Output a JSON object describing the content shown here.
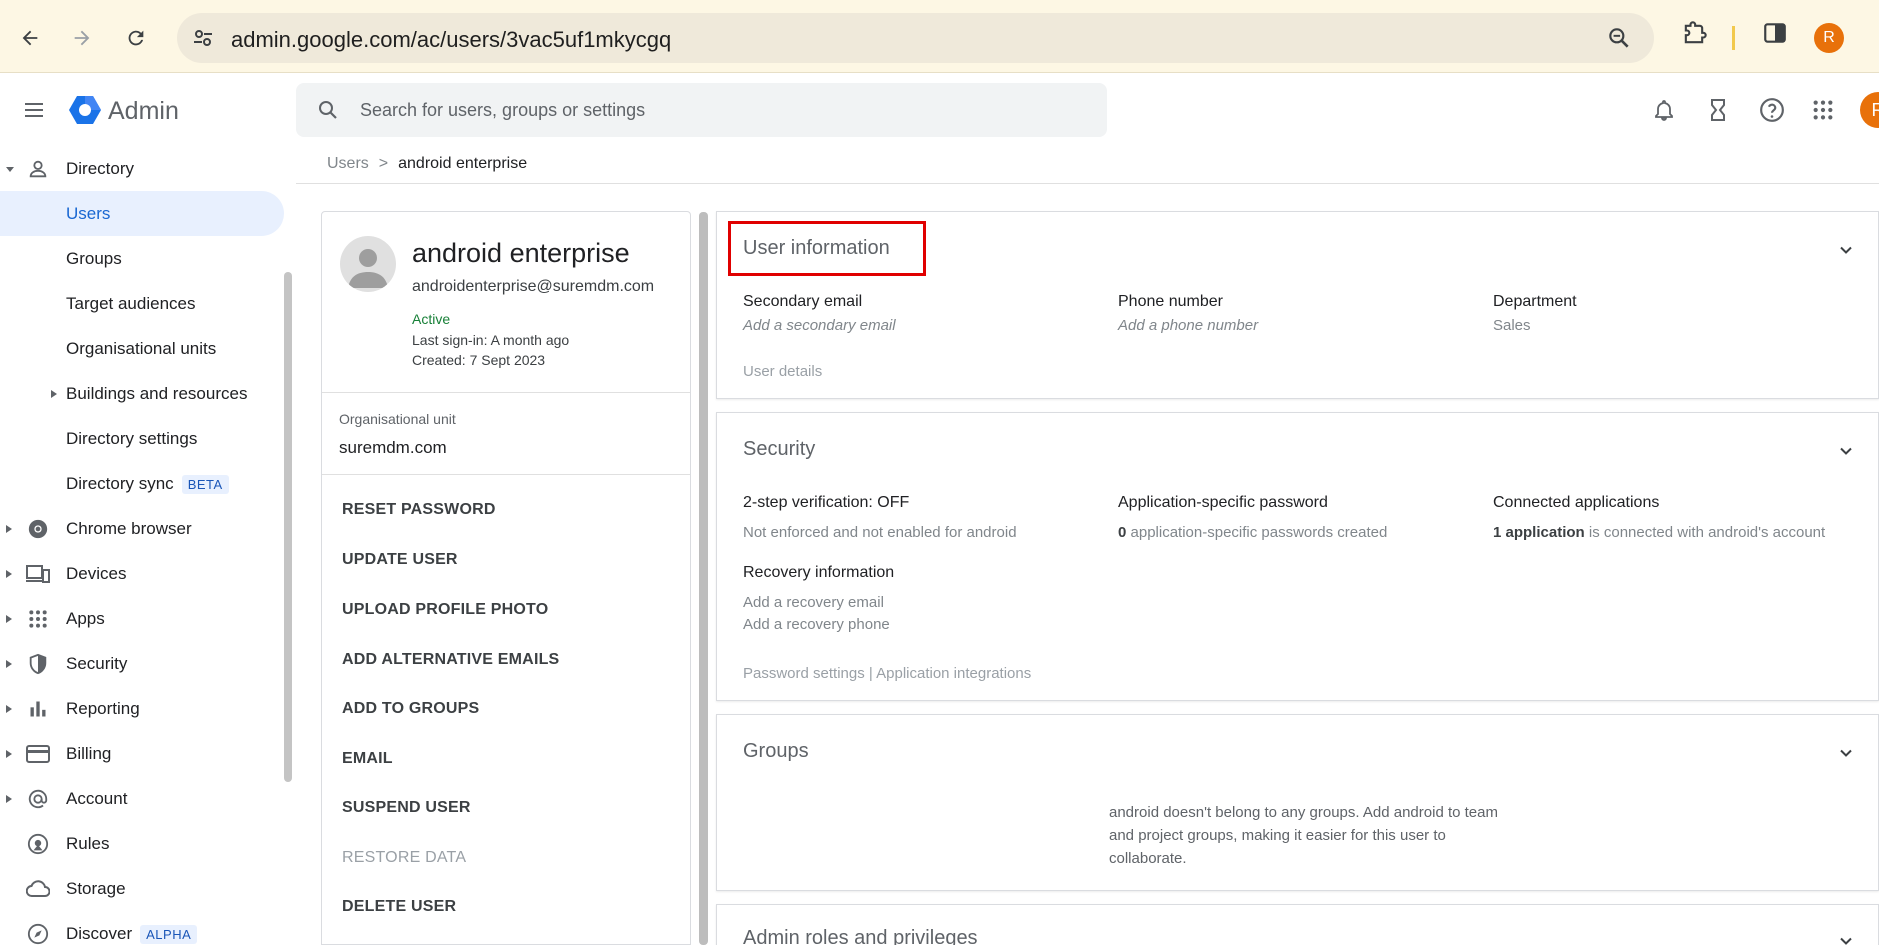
{
  "browser": {
    "url": "admin.google.com/ac/users/3vac5uf1mkycgq",
    "profile_initial": "R"
  },
  "header": {
    "app_title": "Admin",
    "search_placeholder": "Search for users, groups or settings",
    "profile_initial": "R"
  },
  "sidebar": {
    "items": [
      {
        "label": "Directory",
        "icon": "person-icon"
      },
      {
        "label": "Users"
      },
      {
        "label": "Groups"
      },
      {
        "label": "Target audiences"
      },
      {
        "label": "Organisational units"
      },
      {
        "label": "Buildings and resources"
      },
      {
        "label": "Directory settings"
      },
      {
        "label": "Directory sync",
        "badge": "BETA"
      },
      {
        "label": "Chrome browser",
        "icon": "chrome-icon"
      },
      {
        "label": "Devices",
        "icon": "devices-icon"
      },
      {
        "label": "Apps",
        "icon": "apps-grid-icon"
      },
      {
        "label": "Security",
        "icon": "shield-icon"
      },
      {
        "label": "Reporting",
        "icon": "bar-chart-icon"
      },
      {
        "label": "Billing",
        "icon": "credit-card-icon"
      },
      {
        "label": "Account",
        "icon": "at-sign-icon"
      },
      {
        "label": "Rules",
        "icon": "rules-icon"
      },
      {
        "label": "Storage",
        "icon": "cloud-icon"
      },
      {
        "label": "Discover",
        "icon": "compass-icon",
        "badge": "ALPHA"
      }
    ]
  },
  "breadcrumb": {
    "parent": "Users",
    "separator": ">",
    "current": "android enterprise"
  },
  "user_card": {
    "name": "android enterprise",
    "email": "androidenterprise@suremdm.com",
    "status": "Active",
    "last_signin": "Last sign-in: A month ago",
    "created": "Created: 7 Sept 2023",
    "ou_label": "Organisational unit",
    "ou_value": "suremdm.com",
    "actions": [
      "RESET PASSWORD",
      "UPDATE USER",
      "UPLOAD PROFILE PHOTO",
      "ADD ALTERNATIVE EMAILS",
      "ADD TO GROUPS",
      "EMAIL",
      "SUSPEND USER",
      "RESTORE DATA",
      "DELETE USER"
    ]
  },
  "user_info": {
    "title": "User information",
    "secondary_email_label": "Secondary email",
    "secondary_email_value": "Add a secondary email",
    "phone_label": "Phone number",
    "phone_value": "Add a phone number",
    "department_label": "Department",
    "department_value": "Sales",
    "details_link": "User details"
  },
  "security": {
    "title": "Security",
    "two_step_label": "2-step verification: OFF",
    "two_step_value": "Not enforced and not enabled for android",
    "app_pw_label": "Application-specific password",
    "app_pw_count": "0",
    "app_pw_text": " application-specific passwords created",
    "connected_label": "Connected applications",
    "connected_count": "1 application",
    "connected_text": " is connected with android's account",
    "recovery_label": "Recovery information",
    "recovery_email": "Add a recovery email",
    "recovery_phone": "Add a recovery phone",
    "links": "Password settings | Application integrations"
  },
  "groups": {
    "title": "Groups",
    "message": "android doesn't belong to any groups. Add android to team and project groups, making it easier for this user to collaborate."
  },
  "admin_roles": {
    "title": "Admin roles and privileges"
  },
  "colors": {
    "accent": "#1a73e8",
    "active_bg": "#e8f0fe",
    "status_green": "#188038",
    "highlight_red": "#e00000"
  }
}
